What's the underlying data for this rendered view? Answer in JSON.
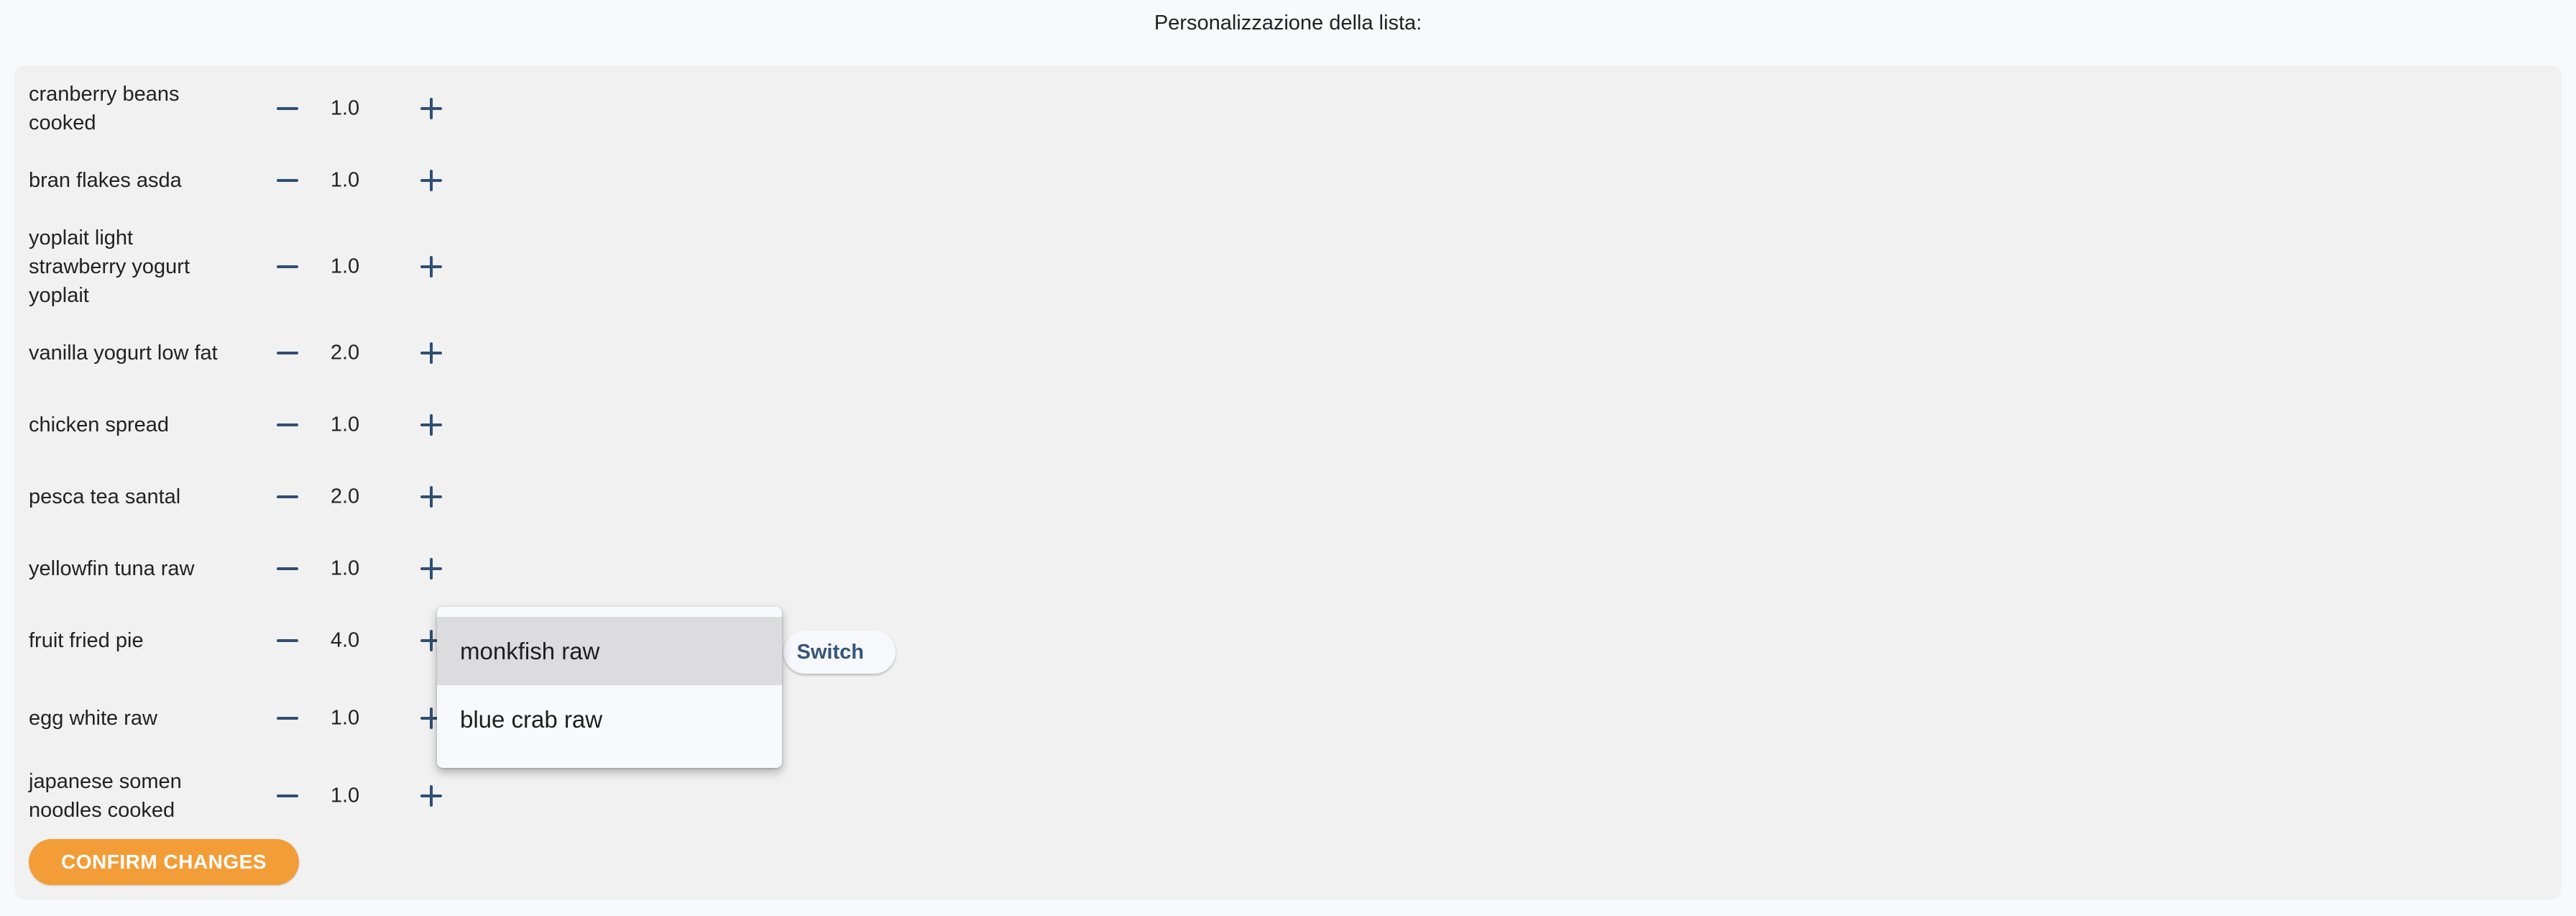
{
  "header": {
    "title": "Personalizzazione della lista:"
  },
  "items": [
    {
      "name": "cranberry beans cooked",
      "qty": "1.0"
    },
    {
      "name": "bran flakes asda",
      "qty": "1.0"
    },
    {
      "name": "yoplait light strawberry yogurt yoplait",
      "qty": "1.0"
    },
    {
      "name": "vanilla yogurt low fat",
      "qty": "2.0"
    },
    {
      "name": "chicken spread",
      "qty": "1.0"
    },
    {
      "name": "pesca tea santal",
      "qty": "2.0"
    },
    {
      "name": "yellowfin tuna raw",
      "qty": "1.0"
    },
    {
      "name": "fruit fried pie",
      "qty": "4.0"
    },
    {
      "name": "egg white raw",
      "qty": "1.0"
    },
    {
      "name": "japanese somen noodles cooked",
      "qty": "1.0"
    }
  ],
  "icons": {
    "decrement": "minus-icon",
    "increment": "plus-icon"
  },
  "switch": {
    "label": "Switch"
  },
  "dropdown": {
    "options": [
      {
        "label": "monkfish raw",
        "selected": true
      },
      {
        "label": "blue crab raw",
        "selected": false
      }
    ]
  },
  "confirm": {
    "label": "CONFIRM CHANGES"
  },
  "colors": {
    "accent": "#f39d38",
    "control": "#2f4f73",
    "panel": "#f1f1f1",
    "background": "#f8f9fd"
  }
}
